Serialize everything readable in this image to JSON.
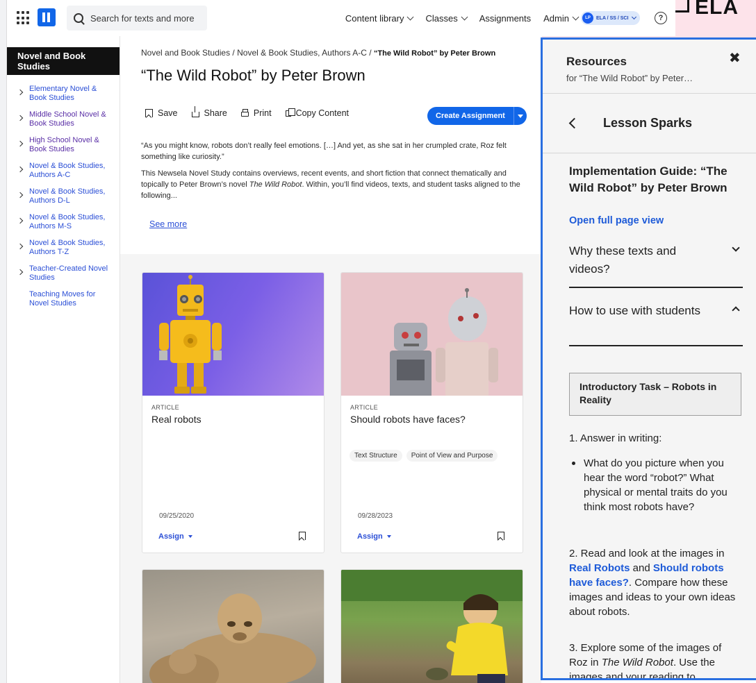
{
  "brand": {
    "subject_mark": "ELA",
    "accent": "#1166e8",
    "panel_border": "#2a6fe0"
  },
  "topnav": {
    "search_placeholder": "Search for texts and more",
    "menu": [
      {
        "label": "Content library",
        "has_dropdown": true
      },
      {
        "label": "Classes",
        "has_dropdown": true
      },
      {
        "label": "Assignments",
        "has_dropdown": false
      },
      {
        "label": "Admin",
        "has_dropdown": true
      }
    ],
    "user": {
      "initials": "LP",
      "label": "ELA / SS / SCI"
    },
    "help_label": "?"
  },
  "sidebar": {
    "title": "Novel and Book Studies",
    "items": [
      {
        "label": "Elementary Novel & Book Studies",
        "arrow": true,
        "visited": false
      },
      {
        "label": "Middle School Novel & Book Studies",
        "arrow": true,
        "visited": true
      },
      {
        "label": "High School Novel & Book Studies",
        "arrow": true,
        "visited": true
      },
      {
        "label": "Novel & Book Studies, Authors A-C",
        "arrow": true,
        "visited": false
      },
      {
        "label": "Novel & Book Studies, Authors D-L",
        "arrow": true,
        "visited": false
      },
      {
        "label": "Novel & Book Studies, Authors M-S",
        "arrow": true,
        "visited": false
      },
      {
        "label": "Novel & Book Studies, Authors T-Z",
        "arrow": true,
        "visited": false
      },
      {
        "label": "Teacher-Created Novel Studies",
        "arrow": true,
        "visited": false
      },
      {
        "label": "Teaching Moves for Novel Studies",
        "arrow": false,
        "visited": false
      }
    ]
  },
  "main": {
    "breadcrumb": {
      "crumb1": "Novel and Book Studies",
      "crumb2": "Novel & Book Studies, Authors A-C",
      "current": "“The Wild Robot” by Peter Brown",
      "sep": " / "
    },
    "title": "“The Wild Robot” by Peter Brown",
    "actions": {
      "save": "Save",
      "share": "Share",
      "print": "Print",
      "copy": "Copy Content"
    },
    "create_assignment": "Create Assignment",
    "quote": "“As you might know, robots don’t really feel emotions. […] And yet, as she sat in her crumpled crate, Roz felt something like curiosity.”",
    "desc_before": "This Newsela Novel Study contains overviews, recent events, and short fiction that connect thematically and topically to Peter Brown’s novel ",
    "desc_book": "The Wild Robot",
    "desc_after": ". Within, you’ll find videos, texts, and student tasks aligned to the following...",
    "see_more": "See more",
    "cards": [
      {
        "kind": "ARTICLE",
        "title": "Real robots",
        "tags": [],
        "date": "09/25/2020",
        "assign": "Assign"
      },
      {
        "kind": "ARTICLE",
        "title": "Should robots have faces?",
        "tags": [
          "Text Structure",
          "Point of View and Purpose"
        ],
        "date": "09/28/2023",
        "assign": "Assign"
      }
    ]
  },
  "panel": {
    "title": "Resources",
    "subtitle": "for “The Wild Robot” by Peter…",
    "close": "✖",
    "section": "Lesson Sparks",
    "guide_title": "Implementation Guide: “The Wild Robot” by Peter Brown",
    "open_full": "Open full page view",
    "accordion": [
      {
        "label": "Why these texts and videos?",
        "expanded": false
      },
      {
        "label": "How to use with students",
        "expanded": true
      }
    ],
    "intro_task": "Introductory Task – Robots in Reality",
    "step1": "1. Answer in writing:",
    "bullet1": "What do you picture when you hear the word “robot?” What physical or mental traits do you think most robots have?",
    "step2_before": "2. Read and look at the images in ",
    "step2_link1": "Real Robots",
    "step2_mid": " and ",
    "step2_link2": "Should robots have faces?",
    "step2_after": ". Compare how these images and ideas to your own ideas about robots.",
    "step3_before": "3. Explore some of the images of Roz in ",
    "step3_book": "The Wild Robot",
    "step3_after": ". Use the images and your reading to"
  }
}
